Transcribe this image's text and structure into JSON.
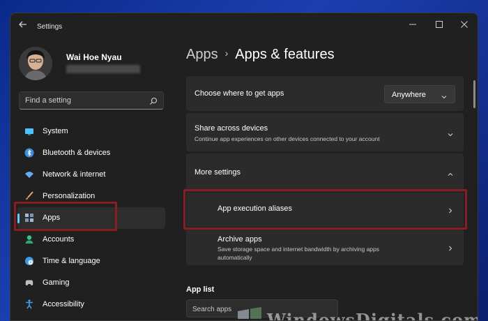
{
  "window": {
    "title": "Settings"
  },
  "profile": {
    "name": "Wai Hoe Nyau"
  },
  "search": {
    "placeholder": "Find a setting"
  },
  "nav": {
    "items": [
      {
        "label": "System",
        "icon": "monitor-icon",
        "color": "#4cc2ff"
      },
      {
        "label": "Bluetooth & devices",
        "icon": "bluetooth-icon",
        "color": "#3a8fde"
      },
      {
        "label": "Network & internet",
        "icon": "wifi-icon",
        "color": "#60aef5"
      },
      {
        "label": "Personalization",
        "icon": "brush-icon",
        "color": "#e8a86a"
      },
      {
        "label": "Apps",
        "icon": "apps-icon",
        "color": "#a1b9d9",
        "selected": true
      },
      {
        "label": "Accounts",
        "icon": "person-icon",
        "color": "#3bc18a"
      },
      {
        "label": "Time & language",
        "icon": "globe-clock-icon",
        "color": "#3a9be6"
      },
      {
        "label": "Gaming",
        "icon": "gamepad-icon",
        "color": "#bfbfbf"
      },
      {
        "label": "Accessibility",
        "icon": "accessibility-icon",
        "color": "#3ca0ef"
      }
    ]
  },
  "breadcrumb": {
    "parent": "Apps",
    "separator": "›",
    "current": "Apps & features"
  },
  "cards": {
    "choose_apps": {
      "title": "Choose where to get apps",
      "dropdown_value": "Anywhere"
    },
    "share_devices": {
      "title": "Share across devices",
      "description": "Continue app experiences on other devices connected to your account"
    },
    "more_settings": {
      "title": "More settings"
    },
    "aliases": {
      "title": "App execution aliases"
    },
    "archive": {
      "title": "Archive apps",
      "description": "Save storage space and internet bandwidth by archiving apps automatically"
    }
  },
  "app_list": {
    "heading": "App list",
    "search_placeholder": "Search apps"
  },
  "watermark": {
    "text": "WindowsDigitals.com"
  },
  "colors": {
    "accent": "#60cdff",
    "highlight": "#8a1d24",
    "card": "#2b2b2b",
    "window": "#202020"
  }
}
